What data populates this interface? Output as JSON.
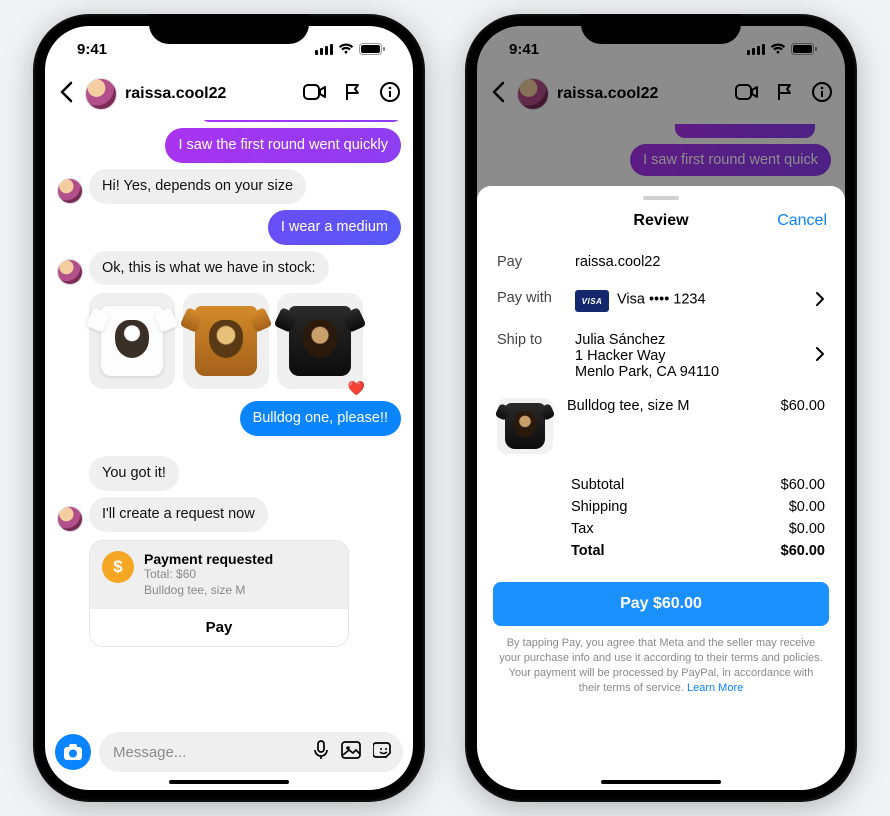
{
  "status": {
    "time": "9:41"
  },
  "header": {
    "username": "raissa.cool22"
  },
  "chat": {
    "m1": "I saw the first round went quickly",
    "m2": "Hi! Yes, depends on your size",
    "m3": "I wear a medium",
    "m4": "Ok, this is what we have in stock:",
    "m5": "Bulldog one, please!!",
    "m6": "You got it!",
    "m7": "I'll create a request now"
  },
  "paycard": {
    "title": "Payment requested",
    "total_line": "Total: $60",
    "desc": "Bulldog tee, size M",
    "button": "Pay"
  },
  "composer": {
    "placeholder": "Message..."
  },
  "ghost": {
    "bubble": "I saw first round went quick"
  },
  "sheet": {
    "title": "Review",
    "cancel": "Cancel",
    "pay_label": "Pay",
    "payee": "raissa.cool22",
    "paywith_label": "Pay with",
    "paywith_value": "Visa •••• 1234",
    "shipto_label": "Ship to",
    "ship_name": "Julia Sánchez",
    "ship_addr1": "1 Hacker Way",
    "ship_addr2": "Menlo Park, CA 94110",
    "item_name": "Bulldog tee, size M",
    "item_price": "$60.00",
    "subtotal_l": "Subtotal",
    "subtotal_v": "$60.00",
    "shipping_l": "Shipping",
    "shipping_v": "$0.00",
    "tax_l": "Tax",
    "tax_v": "$0.00",
    "total_l": "Total",
    "total_v": "$60.00",
    "paybtn": "Pay $60.00",
    "legal": "By tapping Pay, you agree that Meta and the seller may receive your purchase info and use it according to their terms and policies. Your payment will be processed by PayPal, in accordance with their terms of service.",
    "learn": "Learn More"
  }
}
